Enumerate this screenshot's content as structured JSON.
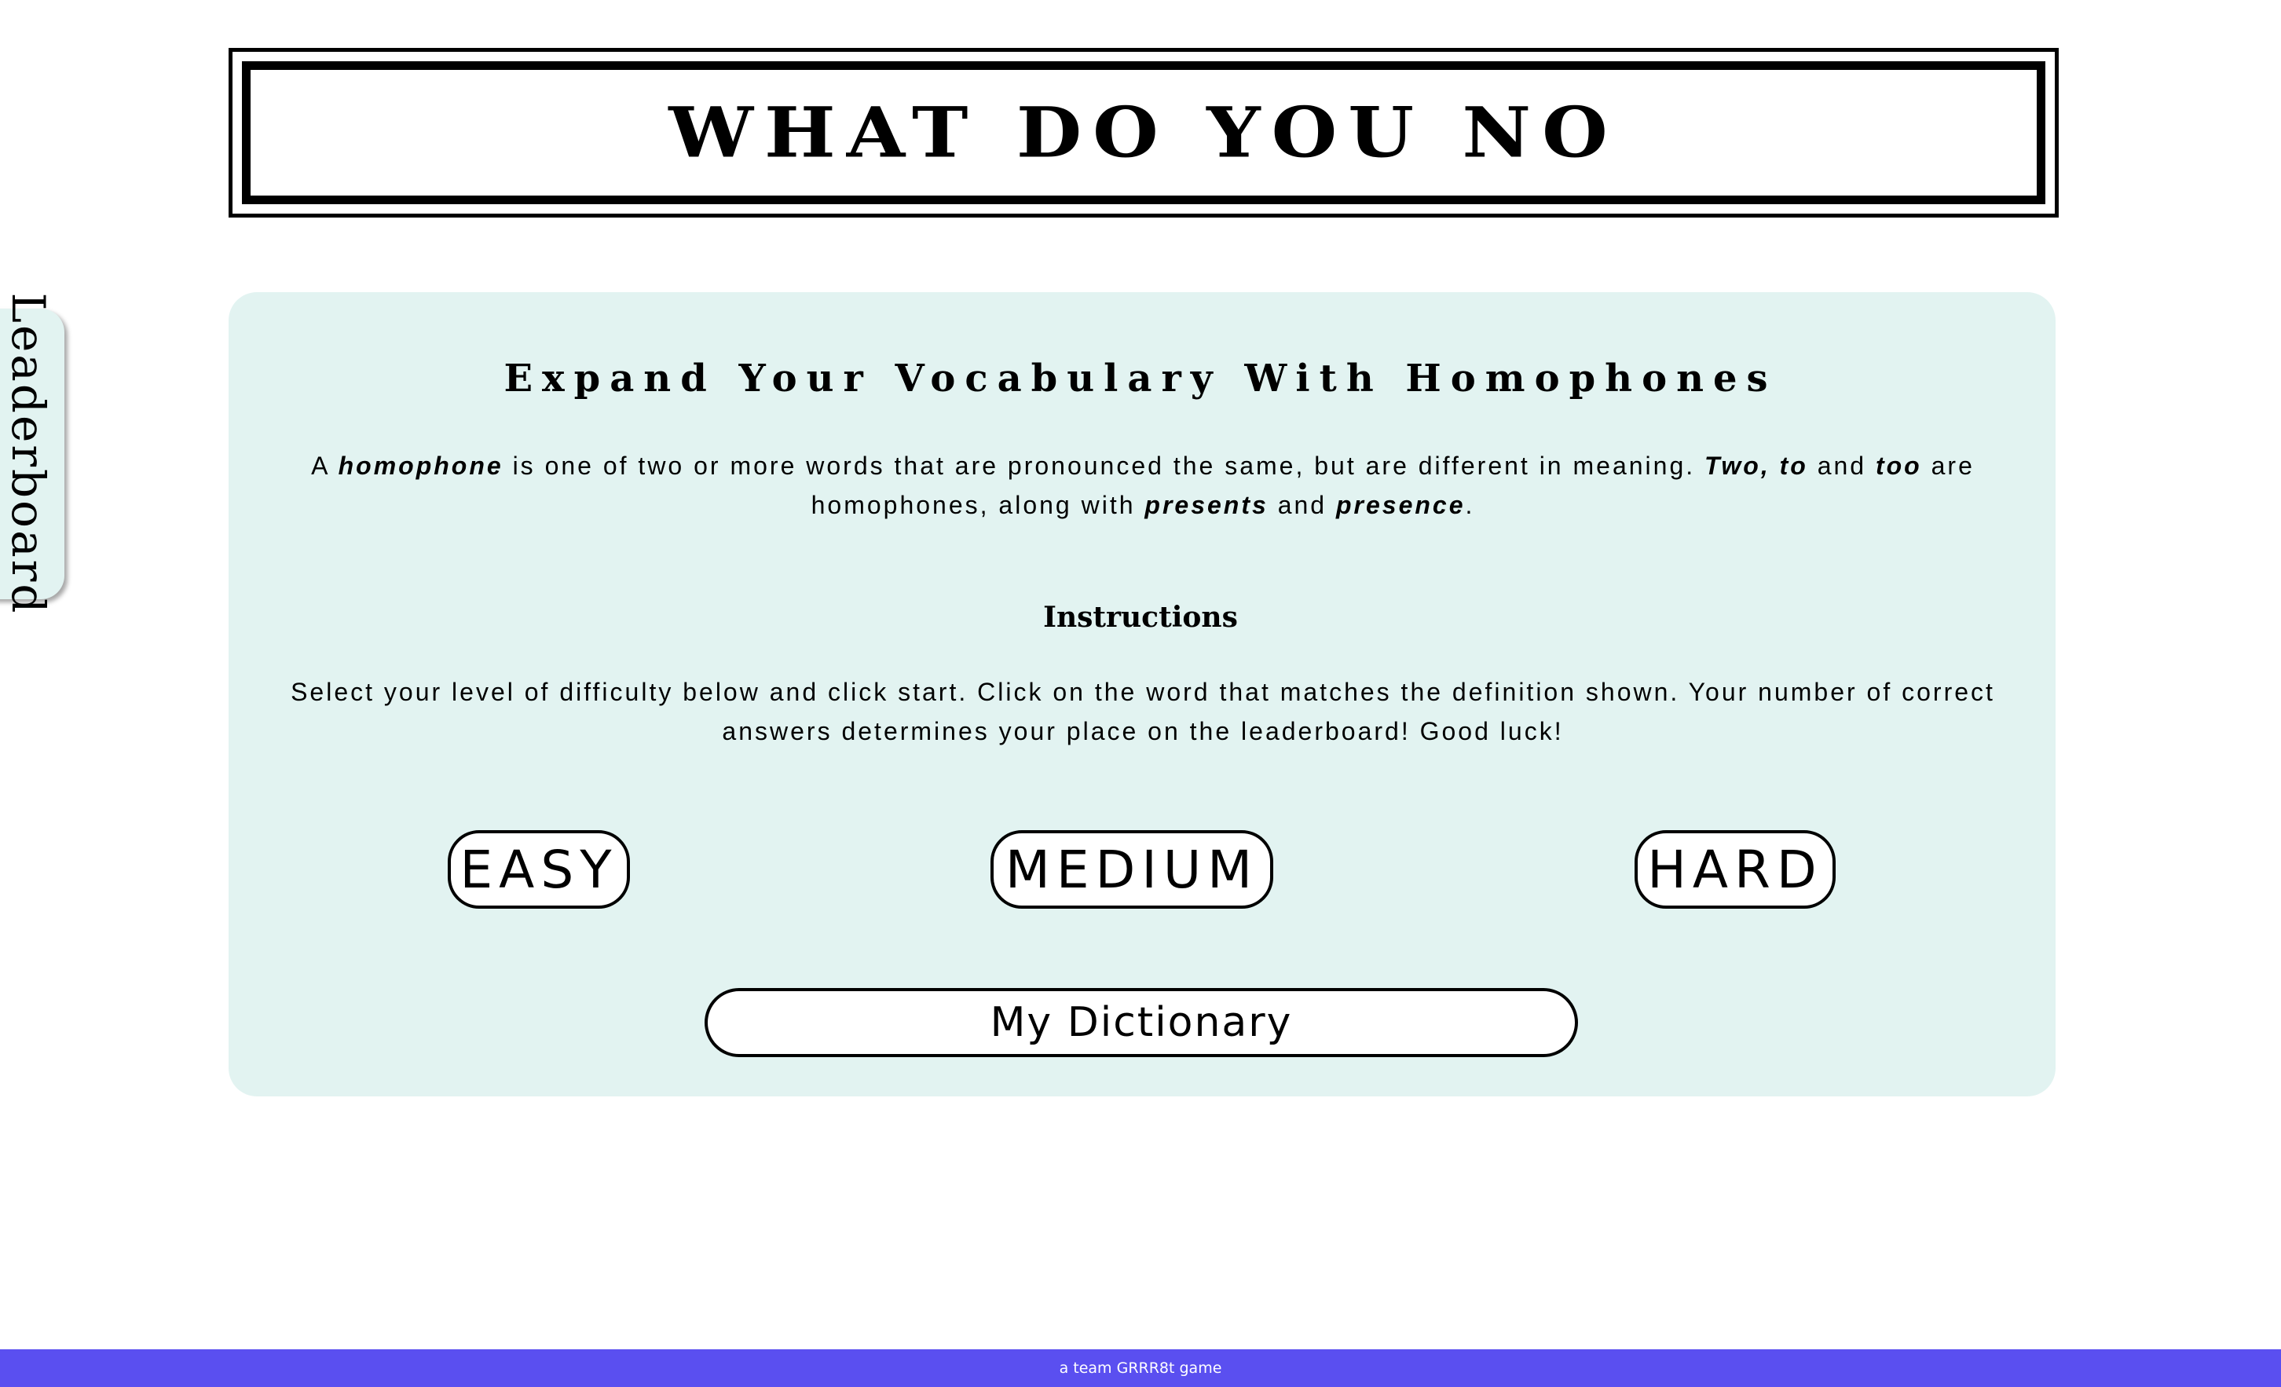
{
  "header": {
    "title": "WHAT DO YOU NO"
  },
  "leaderboard_tab": {
    "label": "Leaderboard"
  },
  "main": {
    "heading": "Expand Your Vocabulary With Homophones",
    "intro": {
      "part1": "A ",
      "term": "homophone",
      "part2": " is one of two or more words that are pronounced the same, but are different in meaning. ",
      "example1": "Two, to",
      "part3": " and ",
      "example2": "too",
      "part4": " are homophones, along with ",
      "example3": "presents",
      "part5": " and ",
      "example4": "presence",
      "part6": "."
    },
    "instructions_heading": "Instructions",
    "instructions_text": "Select your level of difficulty below and click start. Click on the word that matches the definition shown. Your number of correct answers determines your place on the leaderboard! Good luck!",
    "levels": {
      "easy": "EASY",
      "medium": "MEDIUM",
      "hard": "HARD"
    },
    "dictionary_button": "My Dictionary"
  },
  "footer": {
    "text": "a team GRRR8t game"
  },
  "colors": {
    "panel_background": "#e2f3f1",
    "footer_background": "#5a4ff0"
  }
}
